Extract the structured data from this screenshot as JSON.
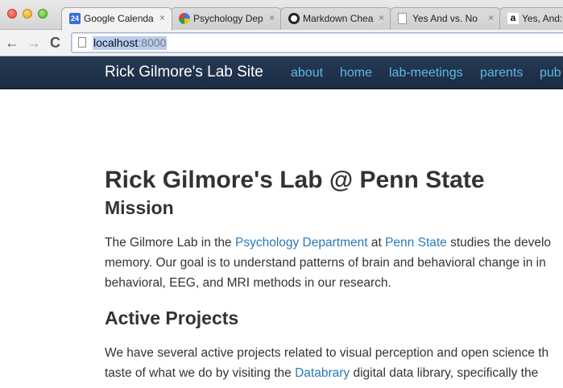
{
  "browser": {
    "tabs": [
      {
        "title": "Google Calenda",
        "favicon": "calendar-icon",
        "badge": "24",
        "close": "×"
      },
      {
        "title": "Psychology Dep",
        "favicon": "psu-icon",
        "close": "×"
      },
      {
        "title": "Markdown Chea",
        "favicon": "github-icon",
        "close": "×"
      },
      {
        "title": "Yes And vs. No",
        "favicon": "document-icon",
        "close": "×"
      },
      {
        "title": "Yes, And:",
        "favicon": "amazon-icon",
        "badge": "a",
        "close": "×"
      }
    ],
    "nav": {
      "back": "←",
      "forward": "→",
      "reload": "C"
    },
    "address": {
      "host": "localhost",
      "port": ":8000"
    }
  },
  "site": {
    "brand": "Rick Gilmore's Lab Site",
    "nav": [
      "about",
      "home",
      "lab-meetings",
      "parents",
      "pub"
    ]
  },
  "page": {
    "title": "Rick Gilmore's Lab @ Penn State",
    "mission_heading": "Mission",
    "mission": {
      "line1_a": "The Gilmore Lab in the ",
      "line1_link1": "Psychology Department",
      "line1_b": " at ",
      "line1_link2": "Penn State",
      "line1_c": " studies the develo",
      "line2": "memory. Our goal is to understand patterns of brain and behavioral change in in",
      "line3": "behavioral, EEG, and MRI methods in our research."
    },
    "projects_heading": "Active Projects",
    "projects": {
      "line1": "We have several active projects related to visual perception and open science th",
      "line2_a": "taste of what we do by visiting the ",
      "line2_link": "Databrary",
      "line2_b": " digital data library, specifically the"
    }
  },
  "colors": {
    "navbar": "#1f3049",
    "link": "#2a7ab8",
    "navlink": "#5cb8e6"
  }
}
